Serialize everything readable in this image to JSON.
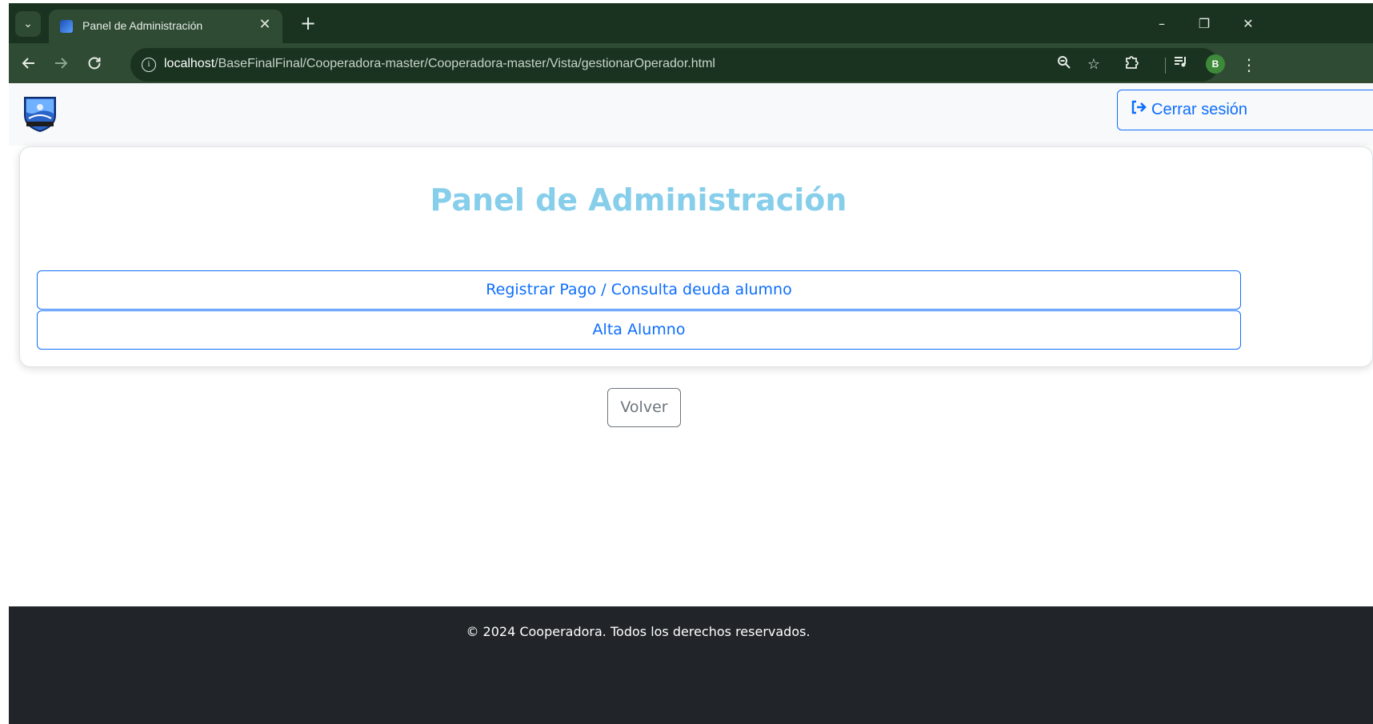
{
  "browser": {
    "tab_title": "Panel de Administración",
    "tab_close": "✕",
    "new_tab": "+",
    "tab_list": "⌄",
    "url_host": "localhost",
    "url_path": "/BaseFinalFinal/Cooperadora-master/Cooperadora-master/Vista/gestionarOperador.html",
    "profile_initial": "B",
    "window_controls": {
      "minimize": "–",
      "restore": "❐",
      "close": "✕"
    },
    "icons": {
      "back": "back-arrow-icon",
      "forward": "forward-arrow-icon",
      "reload": "reload-icon",
      "site_info": "info-icon",
      "zoom": "zoom-icon",
      "bookmark": "star-icon",
      "extensions": "puzzle-icon",
      "media": "media-control-icon",
      "menu": "kebab-menu-icon"
    }
  },
  "navbar": {
    "logout_label": "Cerrar sesión",
    "logout_icon": "sign-out-icon"
  },
  "card": {
    "title": "Panel de Administración",
    "buttons": [
      {
        "label": "Registrar Pago / Consulta deuda alumno"
      },
      {
        "label": "Alta Alumno"
      }
    ]
  },
  "back_button": "Volver",
  "footer": {
    "text": "© 2024 Cooperadora. Todos los derechos reservados."
  },
  "colors": {
    "chrome_bg": "#1a3320",
    "toolbar_bg": "#2f4b34",
    "primary": "#0d6efd",
    "secondary": "#6c757d",
    "title": "#87ceeb",
    "footer_bg": "#212529",
    "navbar_bg": "#f8f9fa"
  }
}
